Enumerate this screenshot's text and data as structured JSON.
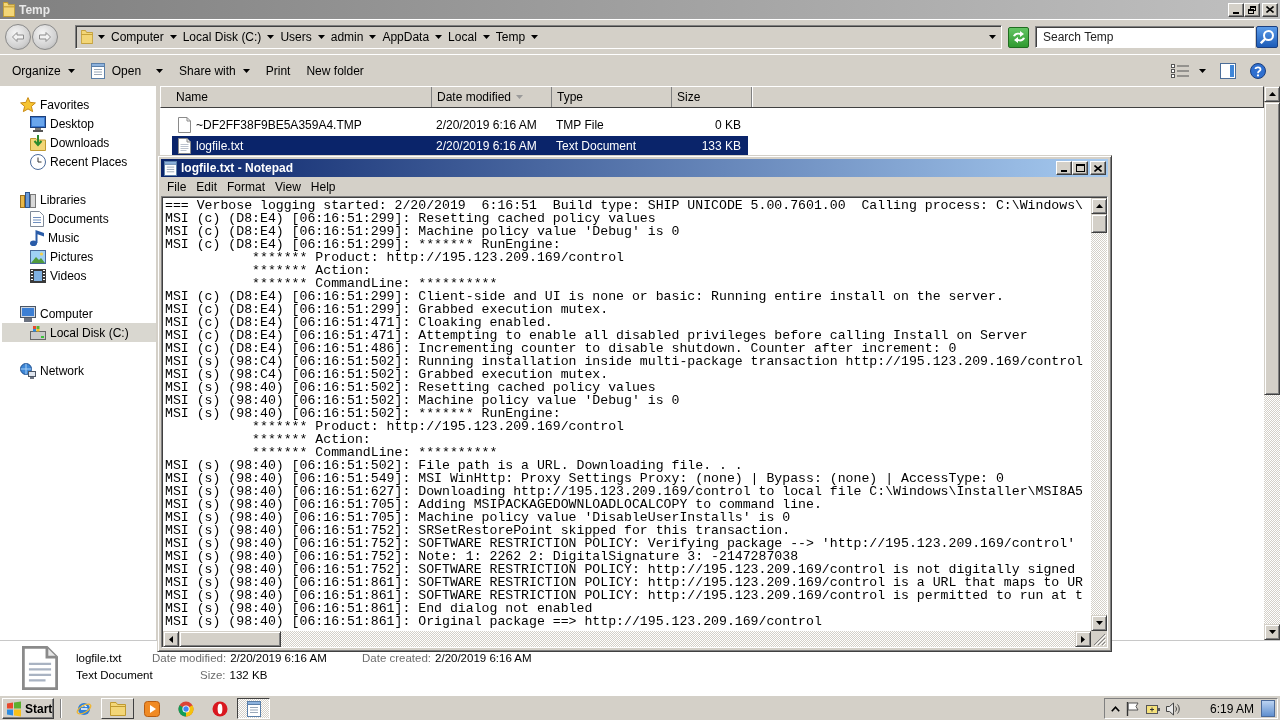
{
  "explorer": {
    "title": "Temp",
    "active": false,
    "breadcrumbs": [
      "Computer",
      "Local Disk (C:)",
      "Users",
      "admin",
      "AppData",
      "Local",
      "Temp"
    ],
    "search": {
      "placeholder": "Search Temp"
    },
    "toolbar": [
      {
        "label": "Organize",
        "kind": "menu"
      },
      {
        "label": "Open",
        "kind": "split"
      },
      {
        "label": "Share with",
        "kind": "menu"
      },
      {
        "label": "Print",
        "kind": "plain"
      },
      {
        "label": "New folder",
        "kind": "plain"
      }
    ],
    "navigation": [
      {
        "label": "Favorites",
        "selected": false,
        "children": [
          {
            "label": "Desktop",
            "selected": false
          },
          {
            "label": "Downloads",
            "selected": false
          },
          {
            "label": "Recent Places",
            "selected": false
          }
        ]
      },
      {
        "label": "Libraries",
        "selected": false,
        "children": [
          {
            "label": "Documents",
            "selected": false
          },
          {
            "label": "Music",
            "selected": false
          },
          {
            "label": "Pictures",
            "selected": false
          },
          {
            "label": "Videos",
            "selected": false
          }
        ]
      },
      {
        "label": "Computer",
        "selected": false,
        "children": [
          {
            "label": "Local Disk (C:)",
            "selected": true
          }
        ]
      },
      {
        "label": "Network",
        "selected": false
      }
    ],
    "columns": [
      {
        "label": "Name",
        "sorted": false
      },
      {
        "label": "Date modified",
        "sorted": true
      },
      {
        "label": "Type",
        "sorted": false
      },
      {
        "label": "Size",
        "sorted": false
      }
    ],
    "rows": [
      {
        "kind": "file",
        "selected": false,
        "cells": [
          "~DF2FF38F9BE5A359A4.TMP",
          "2/20/2019 6:16 AM",
          "TMP File",
          "0 KB"
        ]
      },
      {
        "kind": "text",
        "selected": true,
        "cells": [
          "logfile.txt",
          "2/20/2019 6:16 AM",
          "Text Document",
          "133 KB"
        ]
      }
    ],
    "details": {
      "name": "logfile.txt",
      "type": "Text Document",
      "fields": [
        {
          "label": "Date modified:",
          "value": "2/20/2019 6:16 AM"
        },
        {
          "label": "Size:",
          "value": "132 KB"
        },
        {
          "label": "Date created:",
          "value": "2/20/2019 6:16 AM"
        }
      ]
    }
  },
  "notepad": {
    "title": "logfile.txt - Notepad",
    "active": true,
    "menu": [
      "File",
      "Edit",
      "Format",
      "View",
      "Help"
    ],
    "lines": [
      "=== Verbose logging started: 2/20/2019  6:16:51  Build type: SHIP UNICODE 5.00.7601.00  Calling process: C:\\Windows\\",
      "MSI (c) (D8:E4) [06:16:51:299]: Resetting cached policy values",
      "MSI (c) (D8:E4) [06:16:51:299]: Machine policy value 'Debug' is 0",
      "MSI (c) (D8:E4) [06:16:51:299]: ******* RunEngine:",
      "           ******* Product: http://195.123.209.169/control",
      "           ******* Action:",
      "           ******* CommandLine: **********",
      "MSI (c) (D8:E4) [06:16:51:299]: Client-side and UI is none or basic: Running entire install on the server.",
      "MSI (c) (D8:E4) [06:16:51:299]: Grabbed execution mutex.",
      "MSI (c) (D8:E4) [06:16:51:471]: Cloaking enabled.",
      "MSI (c) (D8:E4) [06:16:51:471]: Attempting to enable all disabled privileges before calling Install on Server",
      "MSI (c) (D8:E4) [06:16:51:486]: Incrementing counter to disable shutdown. Counter after increment: 0",
      "MSI (s) (98:C4) [06:16:51:502]: Running installation inside multi-package transaction http://195.123.209.169/control",
      "MSI (s) (98:C4) [06:16:51:502]: Grabbed execution mutex.",
      "MSI (s) (98:40) [06:16:51:502]: Resetting cached policy values",
      "MSI (s) (98:40) [06:16:51:502]: Machine policy value 'Debug' is 0",
      "MSI (s) (98:40) [06:16:51:502]: ******* RunEngine:",
      "           ******* Product: http://195.123.209.169/control",
      "           ******* Action:",
      "           ******* CommandLine: **********",
      "MSI (s) (98:40) [06:16:51:502]: File path is a URL. Downloading file. . .",
      "MSI (s) (98:40) [06:16:51:549]: MSI WinHttp: Proxy Settings Proxy: (none) | Bypass: (none) | AccessType: 0",
      "MSI (s) (98:40) [06:16:51:627]: Downloading http://195.123.209.169/control to local file C:\\Windows\\Installer\\MSI8A5",
      "MSI (s) (98:40) [06:16:51:705]: Adding MSIPACKAGEDOWNLOADLOCALCOPY to command line.",
      "MSI (s) (98:40) [06:16:51:705]: Machine policy value 'DisableUserInstalls' is 0",
      "MSI (s) (98:40) [06:16:51:752]: SRSetRestorePoint skipped for this transaction.",
      "MSI (s) (98:40) [06:16:51:752]: SOFTWARE RESTRICTION POLICY: Verifying package --> 'http://195.123.209.169/control'",
      "MSI (s) (98:40) [06:16:51:752]: Note: 1: 2262 2: DigitalSignature 3: -2147287038",
      "MSI (s) (98:40) [06:16:51:752]: SOFTWARE RESTRICTION POLICY: http://195.123.209.169/control is not digitally signed",
      "MSI (s) (98:40) [06:16:51:861]: SOFTWARE RESTRICTION POLICY: http://195.123.209.169/control is a URL that maps to UR",
      "MSI (s) (98:40) [06:16:51:861]: SOFTWARE RESTRICTION POLICY: http://195.123.209.169/control is permitted to run at t",
      "MSI (s) (98:40) [06:16:51:861]: End dialog not enabled",
      "MSI (s) (98:40) [06:16:51:861]: Original package ==> http://195.123.209.169/control"
    ]
  },
  "taskbar": {
    "start": "Start",
    "items": [
      {
        "kind": "pinned",
        "selected": false
      },
      {
        "kind": "window",
        "selected": false
      },
      {
        "kind": "pinned",
        "selected": false
      },
      {
        "kind": "pinned",
        "selected": false
      },
      {
        "kind": "pinned",
        "selected": false
      },
      {
        "kind": "window",
        "selected": true
      }
    ],
    "clock": "6:19 AM"
  }
}
